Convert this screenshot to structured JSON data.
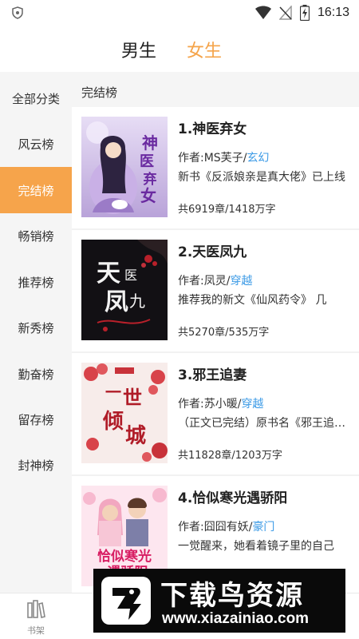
{
  "status_bar": {
    "time": "16:13",
    "icons": [
      "shield-icon",
      "wifi-icon",
      "no-signal-icon",
      "battery-icon"
    ]
  },
  "gender_tabs": {
    "male": "男生",
    "female": "女生",
    "active": "female",
    "accent_color": "#f5a44a"
  },
  "sidebar": {
    "items": [
      {
        "label": "全部分类"
      },
      {
        "label": "风云榜"
      },
      {
        "label": "完结榜",
        "active": true
      },
      {
        "label": "畅销榜"
      },
      {
        "label": "推荐榜"
      },
      {
        "label": "新秀榜"
      },
      {
        "label": "勤奋榜"
      },
      {
        "label": "留存榜"
      },
      {
        "label": "封神榜"
      }
    ]
  },
  "section": {
    "title": "完结榜"
  },
  "books": [
    {
      "title": "1.神医弃女",
      "author_prefix": "作者:",
      "author": "MS芙子",
      "sep": "/",
      "genre": "玄幻",
      "desc": "新书《反派娘亲是真大佬》已上线",
      "stats": "共6919章/1418万字",
      "cover_text": "神医弃女"
    },
    {
      "title": "2.天医凤九",
      "author_prefix": "作者:",
      "author": "凤灵",
      "sep": "/",
      "genre": "穿越",
      "desc": "推荐我的新文《仙风药令》 几",
      "stats": "共5270章/535万字",
      "cover_text": "天医凤九"
    },
    {
      "title": "3.邪王追妻",
      "author_prefix": "作者:",
      "author": "苏小暖",
      "sep": "/",
      "genre": "穿越",
      "desc": "（正文已完结）原书名《邪王追妻》",
      "stats": "共11828章/1203万字",
      "cover_text": "一世倾城"
    },
    {
      "title": "4.恰似寒光遇骄阳",
      "author_prefix": "作者:",
      "author": "囧囧有妖",
      "sep": "/",
      "genre": "豪门",
      "desc": "一觉醒来，她看着镜子里的自己",
      "stats": "",
      "cover_text": "恰似寒光遇骄阳"
    }
  ],
  "bottom_nav": {
    "items": [
      {
        "label": "书架",
        "icon": "bookshelf-icon"
      }
    ]
  },
  "watermark": {
    "title": "下载鸟资源",
    "url": "www.xiazainiao.com"
  }
}
